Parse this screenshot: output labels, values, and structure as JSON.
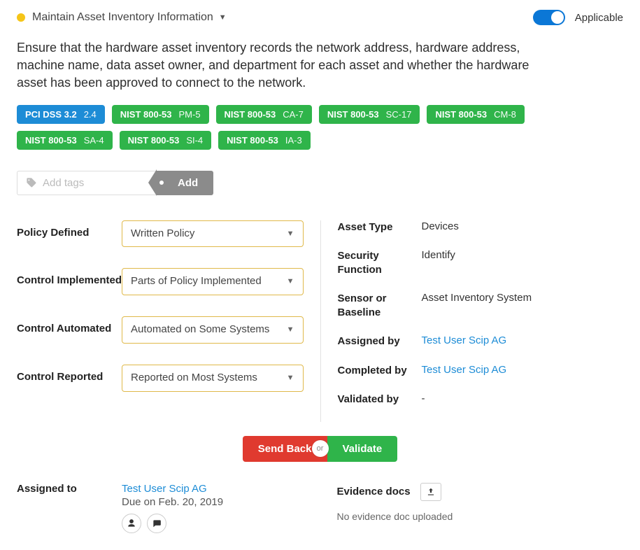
{
  "header": {
    "title": "Maintain Asset Inventory Information",
    "applicable_label": "Applicable",
    "applicable": true
  },
  "description": "Ensure that the hardware asset inventory records the network address, hardware address, machine name, data asset owner, and department for each asset and whether the hardware asset has been approved to connect to the network.",
  "tags": [
    {
      "framework": "PCI DSS 3.2",
      "code": "2.4",
      "color": "blue"
    },
    {
      "framework": "NIST 800-53",
      "code": "PM-5",
      "color": "green"
    },
    {
      "framework": "NIST 800-53",
      "code": "CA-7",
      "color": "green"
    },
    {
      "framework": "NIST 800-53",
      "code": "SC-17",
      "color": "green"
    },
    {
      "framework": "NIST 800-53",
      "code": "CM-8",
      "color": "green"
    },
    {
      "framework": "NIST 800-53",
      "code": "SA-4",
      "color": "green"
    },
    {
      "framework": "NIST 800-53",
      "code": "SI-4",
      "color": "green"
    },
    {
      "framework": "NIST 800-53",
      "code": "IA-3",
      "color": "green"
    }
  ],
  "add_tags": {
    "placeholder": "Add tags",
    "button": "Add"
  },
  "controls": {
    "policy_defined": {
      "label": "Policy Defined",
      "value": "Written Policy"
    },
    "control_implemented": {
      "label": "Control Implemented",
      "value": "Parts of Policy Implemented"
    },
    "control_automated": {
      "label": "Control Automated",
      "value": "Automated on Some Systems"
    },
    "control_reported": {
      "label": "Control Reported",
      "value": "Reported on Most Systems"
    }
  },
  "details": {
    "asset_type": {
      "label": "Asset Type",
      "value": "Devices"
    },
    "security_function": {
      "label": "Security Function",
      "value": "Identify"
    },
    "sensor_or_baseline": {
      "label": "Sensor or Baseline",
      "value": "Asset Inventory System"
    },
    "assigned_by": {
      "label": "Assigned by",
      "value": "Test User Scip AG"
    },
    "completed_by": {
      "label": "Completed by",
      "value": "Test User Scip AG"
    },
    "validated_by": {
      "label": "Validated by",
      "value": "-"
    }
  },
  "actions": {
    "send_back": "Send Back",
    "or": "or",
    "validate": "Validate"
  },
  "assignment": {
    "label": "Assigned to",
    "user": "Test User Scip AG",
    "due": "Due on Feb. 20, 2019"
  },
  "evidence": {
    "label": "Evidence docs",
    "empty": "No evidence doc uploaded"
  }
}
